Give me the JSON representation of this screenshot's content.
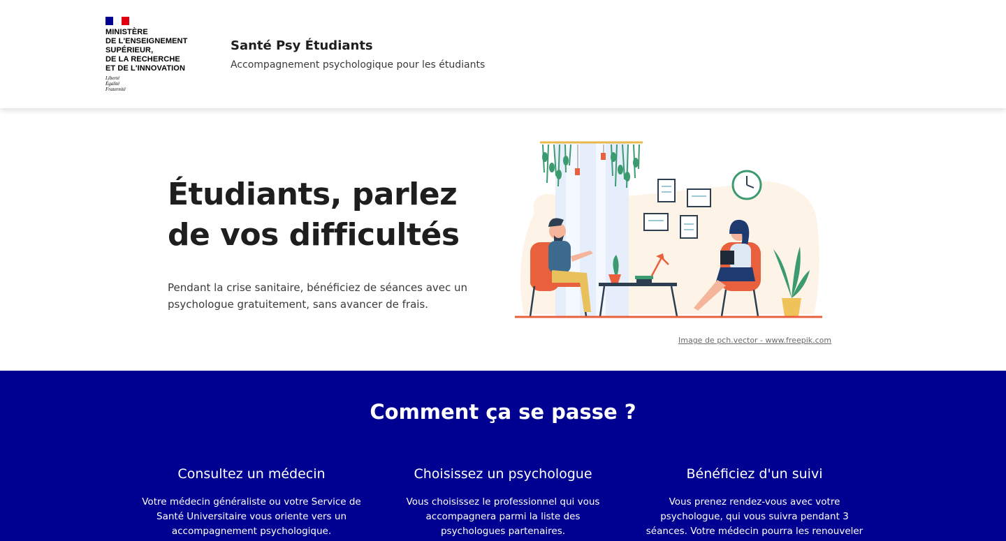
{
  "header": {
    "ministry_lines": "MINISTÈRE\nDE L'ENSEIGNEMENT\nSUPÉRIEUR,\nDE LA RECHERCHE\nET DE L'INNOVATION",
    "devise": "Liberté\nÉgalité\nFraternité",
    "site_name": "Santé Psy Étudiants",
    "site_tagline": "Accompagnement psychologique pour les étudiants"
  },
  "hero": {
    "title": "Étudiants, parlez de vos difficultés",
    "text": "Pendant la crise sanitaire, bénéficiez de séances avec un psychologue gratuitement, sans avancer de frais.",
    "image_credit": "Image de pch.vector - www.freepik.com"
  },
  "how": {
    "title": "Comment ça se passe ?",
    "steps": [
      {
        "title": "Consultez un médecin",
        "text": "Votre médecin généraliste ou votre Service de Santé Universitaire vous oriente vers un accompagnement psychologique."
      },
      {
        "title": "Choisissez un psychologue",
        "text": "Vous choisissez le professionnel qui vous accompagnera parmi la liste des psychologues partenaires."
      },
      {
        "title": "Bénéficiez d'un suivi",
        "text": "Vous prenez rendez-vous avec votre psychologue, qui vous suivra pendant 3 séances. Votre médecin pourra les renouveler"
      }
    ]
  },
  "colors": {
    "primary_blue": "#000091",
    "marianne_red": "#e1000f",
    "illustration_orange": "#e8613c"
  }
}
